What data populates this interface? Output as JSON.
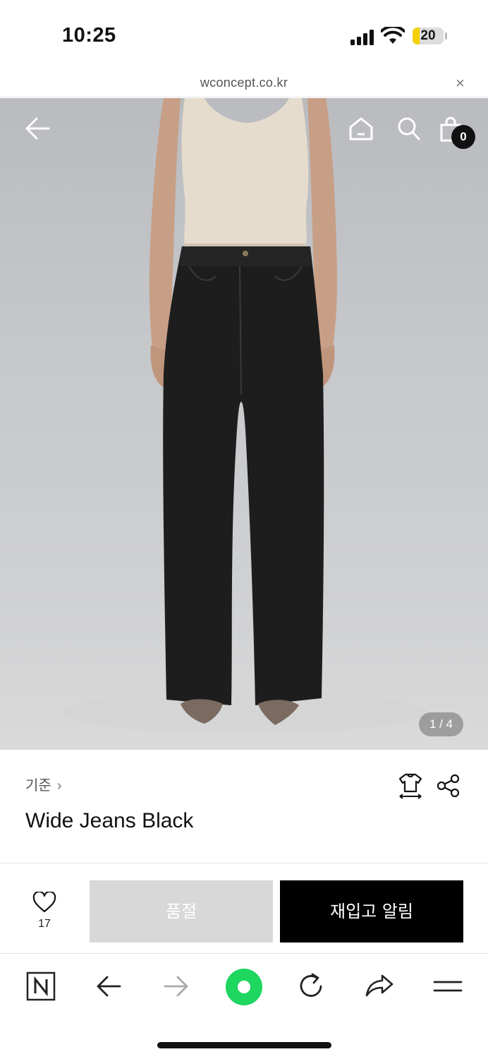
{
  "status_bar": {
    "time": "10:25",
    "battery": "20"
  },
  "url_bar": {
    "domain": "wconcept.co.kr",
    "close": "×"
  },
  "hero": {
    "cart_count": "0",
    "slide_indicator": "1 / 4"
  },
  "product": {
    "brand": "기준",
    "title": "Wide Jeans Black"
  },
  "actions": {
    "wish_count": "17",
    "soldout_label": "품절",
    "restock_label": "재입고 알림"
  },
  "colors": {
    "accent_green": "#1ed760",
    "button_black": "#000000",
    "button_disabled": "#d8d8d8"
  },
  "icons": [
    "back-arrow-icon",
    "home-icon",
    "search-icon",
    "shopping-bag-icon",
    "size-guide-icon",
    "share-icon",
    "heart-icon",
    "naver-icon",
    "back-icon",
    "forward-icon",
    "green-dot-icon",
    "reload-icon",
    "share-arrow-icon",
    "menu-icon"
  ]
}
